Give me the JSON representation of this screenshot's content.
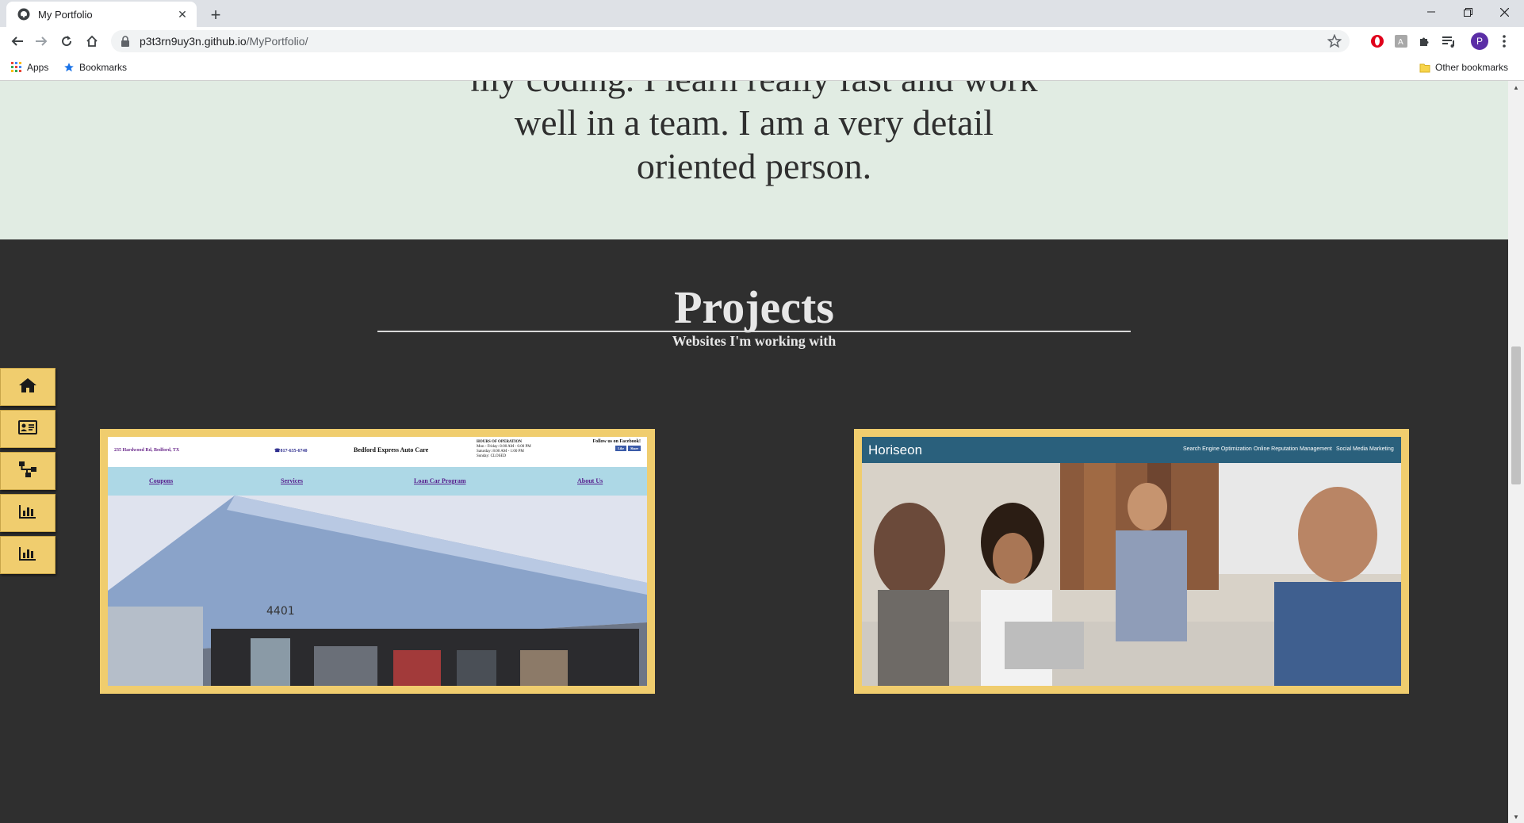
{
  "browser": {
    "tab_title": "My Portfolio",
    "new_tab_symbol": "+",
    "url_host": "p3t3rn9uy3n.github.io",
    "url_path": "/MyPortfolio/",
    "avatar_letter": "P",
    "bookmarks": {
      "apps_label": "Apps",
      "bookmarks_label": "Bookmarks",
      "other_label": "Other bookmarks"
    }
  },
  "about": {
    "lines": [
      "my coding. I learn really fast and work",
      "well in a team. I am a very detail",
      "oriented person."
    ]
  },
  "projects": {
    "title": "Projects",
    "subtitle": "Websites I'm working with",
    "items": [
      {
        "name": "Bedford Express Auto Care",
        "address": "235 Hardwood Rd, Bedford, TX",
        "phone": "817-635-6740",
        "hours_title": "HOURS OF OPERATION",
        "hours": [
          "Mon - Friday: 8:00 AM - 6:00 PM",
          "Saturday: 8:00 AM - 1:00 PM",
          "Sunday: CLOSED"
        ],
        "facebook": "Follow us on Facebook!",
        "fb_like": "Like",
        "fb_share": "Share",
        "nav": [
          "Coupons",
          "Services",
          "Loan Car Program",
          "About Us"
        ],
        "building_number": "4401"
      },
      {
        "name": "Horiseon",
        "nav": [
          "Search Engine Optimization",
          "Online Reputation Management",
          "Social Media Marketing"
        ]
      }
    ]
  },
  "side_nav": {
    "icons": [
      "home-icon",
      "contact-card-icon",
      "sitemap-icon",
      "bar-chart-icon",
      "bar-chart-icon"
    ]
  },
  "colors": {
    "about_bg": "#e1ece3",
    "page_bg": "#2f2f2f",
    "accent_gold": "#f0cd6e",
    "horiseon_blue": "#2a607c",
    "bedford_nav": "#add8e6"
  }
}
